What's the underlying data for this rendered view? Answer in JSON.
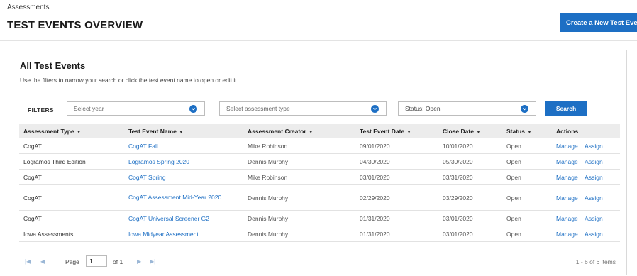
{
  "header": {
    "breadcrumb": "Assessments",
    "title": "TEST EVENTS OVERVIEW",
    "create_button": "Create a New Test Event"
  },
  "panel": {
    "title": "All Test Events",
    "instructions": "Use the filters to narrow your search or click the test event name to open or edit it.",
    "filters_label": "FILTERS",
    "filters": {
      "year_placeholder": "Select year",
      "assessment_type_placeholder": "Select assessment type",
      "status_value": "Status: Open"
    },
    "search_button": "Search"
  },
  "table": {
    "columns": [
      "Assessment Type",
      "Test Event Name",
      "Assessment Creator",
      "Test Event Date",
      "Close Date",
      "Status",
      "Actions"
    ],
    "rows": [
      {
        "type": "CogAT",
        "name": "CogAT Fall",
        "creator": "Mike Robinson",
        "event_date": "09/01/2020",
        "close_date": "10/01/2020",
        "status": "Open",
        "manage": "Manage",
        "assign": "Assign"
      },
      {
        "type": "Logramos Third Edition",
        "name": "Logramos Spring 2020",
        "creator": "Dennis Murphy",
        "event_date": "04/30/2020",
        "close_date": "05/30/2020",
        "status": "Open",
        "manage": "Manage",
        "assign": "Assign"
      },
      {
        "type": "CogAT",
        "name": "CogAT Spring",
        "creator": "Mike Robinson",
        "event_date": "03/01/2020",
        "close_date": "03/31/2020",
        "status": "Open",
        "manage": "Manage",
        "assign": "Assign"
      },
      {
        "type": "CogAT",
        "name": "CogAT Assessment Mid-Year 2020",
        "creator": "Dennis Murphy",
        "event_date": "02/29/2020",
        "close_date": "03/29/2020",
        "status": "Open",
        "manage": "Manage",
        "assign": "Assign"
      },
      {
        "type": "CogAT",
        "name": "CogAT Universal Screener G2",
        "creator": "Dennis Murphy",
        "event_date": "01/31/2020",
        "close_date": "03/01/2020",
        "status": "Open",
        "manage": "Manage",
        "assign": "Assign"
      },
      {
        "type": "Iowa Assessments",
        "name": "Iowa Midyear Assessment",
        "creator": "Dennis Murphy",
        "event_date": "01/31/2020",
        "close_date": "03/01/2020",
        "status": "Open",
        "manage": "Manage",
        "assign": "Assign"
      }
    ]
  },
  "pager": {
    "page_label": "Page",
    "page_value": "1",
    "of_label": "of 1",
    "count": "1 - 6 of 6 items"
  },
  "colors": {
    "accent": "#1d6fc4",
    "header_bg": "#ececec"
  },
  "icons": {
    "select_chevron": "chevron-down-icon",
    "sort": "sort-down-icon",
    "pager": [
      "first-page-icon",
      "prev-page-icon",
      "next-page-icon",
      "last-page-icon"
    ]
  }
}
